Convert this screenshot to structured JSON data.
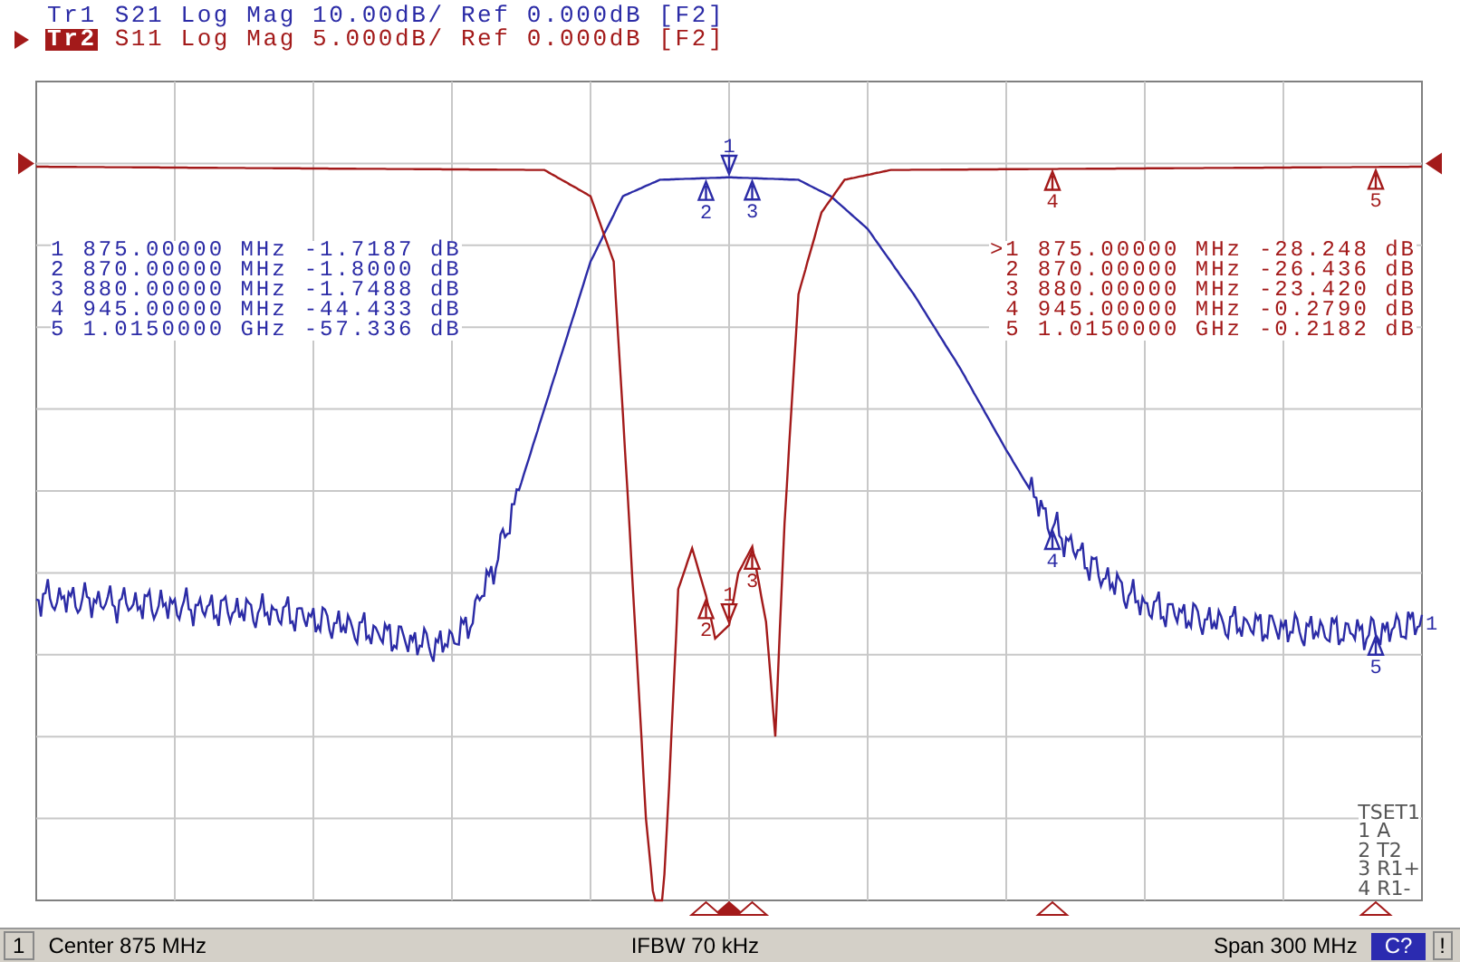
{
  "traces": [
    {
      "label": "Tr1",
      "info": "S21 Log Mag 10.00dB/ Ref 0.000dB [F2]",
      "selected": false,
      "color": "#2b2ba6",
      "end_label": "1",
      "chart_markers": [
        {
          "label": "1",
          "active": true
        },
        {
          "label": "2",
          "active": false
        },
        {
          "label": "3",
          "active": false
        },
        {
          "label": "4",
          "active": false
        },
        {
          "label": "5",
          "active": false
        }
      ],
      "marker_table": [
        {
          "number": "1",
          "stimulus": "875.00000 MHz",
          "response": "-1.7187 dB"
        },
        {
          "number": "2",
          "stimulus": "870.00000 MHz",
          "response": "-1.8000 dB"
        },
        {
          "number": "3",
          "stimulus": "880.00000 MHz",
          "response": "-1.7488 dB"
        },
        {
          "number": "4",
          "stimulus": "945.00000 MHz",
          "response": "-44.433 dB"
        },
        {
          "number": "5",
          "stimulus": "1.0150000 GHz",
          "response": "-57.336 dB"
        }
      ]
    },
    {
      "label": "Tr2",
      "info": "S11 Log Mag 5.000dB/ Ref 0.000dB [F2]",
      "selected": true,
      "color": "#a31a1a",
      "chart_markers": [
        {
          "label": "1",
          "active": true
        },
        {
          "label": "2",
          "active": false
        },
        {
          "label": "3",
          "active": false
        },
        {
          "label": "4",
          "active": false
        },
        {
          "label": "5",
          "active": false
        }
      ],
      "marker_table": [
        {
          "number": ">1",
          "stimulus": "875.00000 MHz",
          "response": "-28.248 dB"
        },
        {
          "number": "2",
          "stimulus": "870.00000 MHz",
          "response": "-26.436 dB"
        },
        {
          "number": "3",
          "stimulus": "880.00000 MHz",
          "response": "-23.420 dB"
        },
        {
          "number": "4",
          "stimulus": "945.00000 MHz",
          "response": "-0.2790 dB"
        },
        {
          "number": "5",
          "stimulus": "1.0150000 GHz",
          "response": "-0.2182 dB"
        }
      ]
    }
  ],
  "calibration": {
    "title": "TSET1",
    "lines": [
      "1 A",
      "2 T2",
      "3 R1+",
      "4 R1-"
    ]
  },
  "status_bar": {
    "channel": "1",
    "center": "Center 875 MHz",
    "ifbw": "IFBW 70 kHz",
    "span": "Span 300 MHz",
    "cal_status": "C?",
    "alert": "!"
  }
}
